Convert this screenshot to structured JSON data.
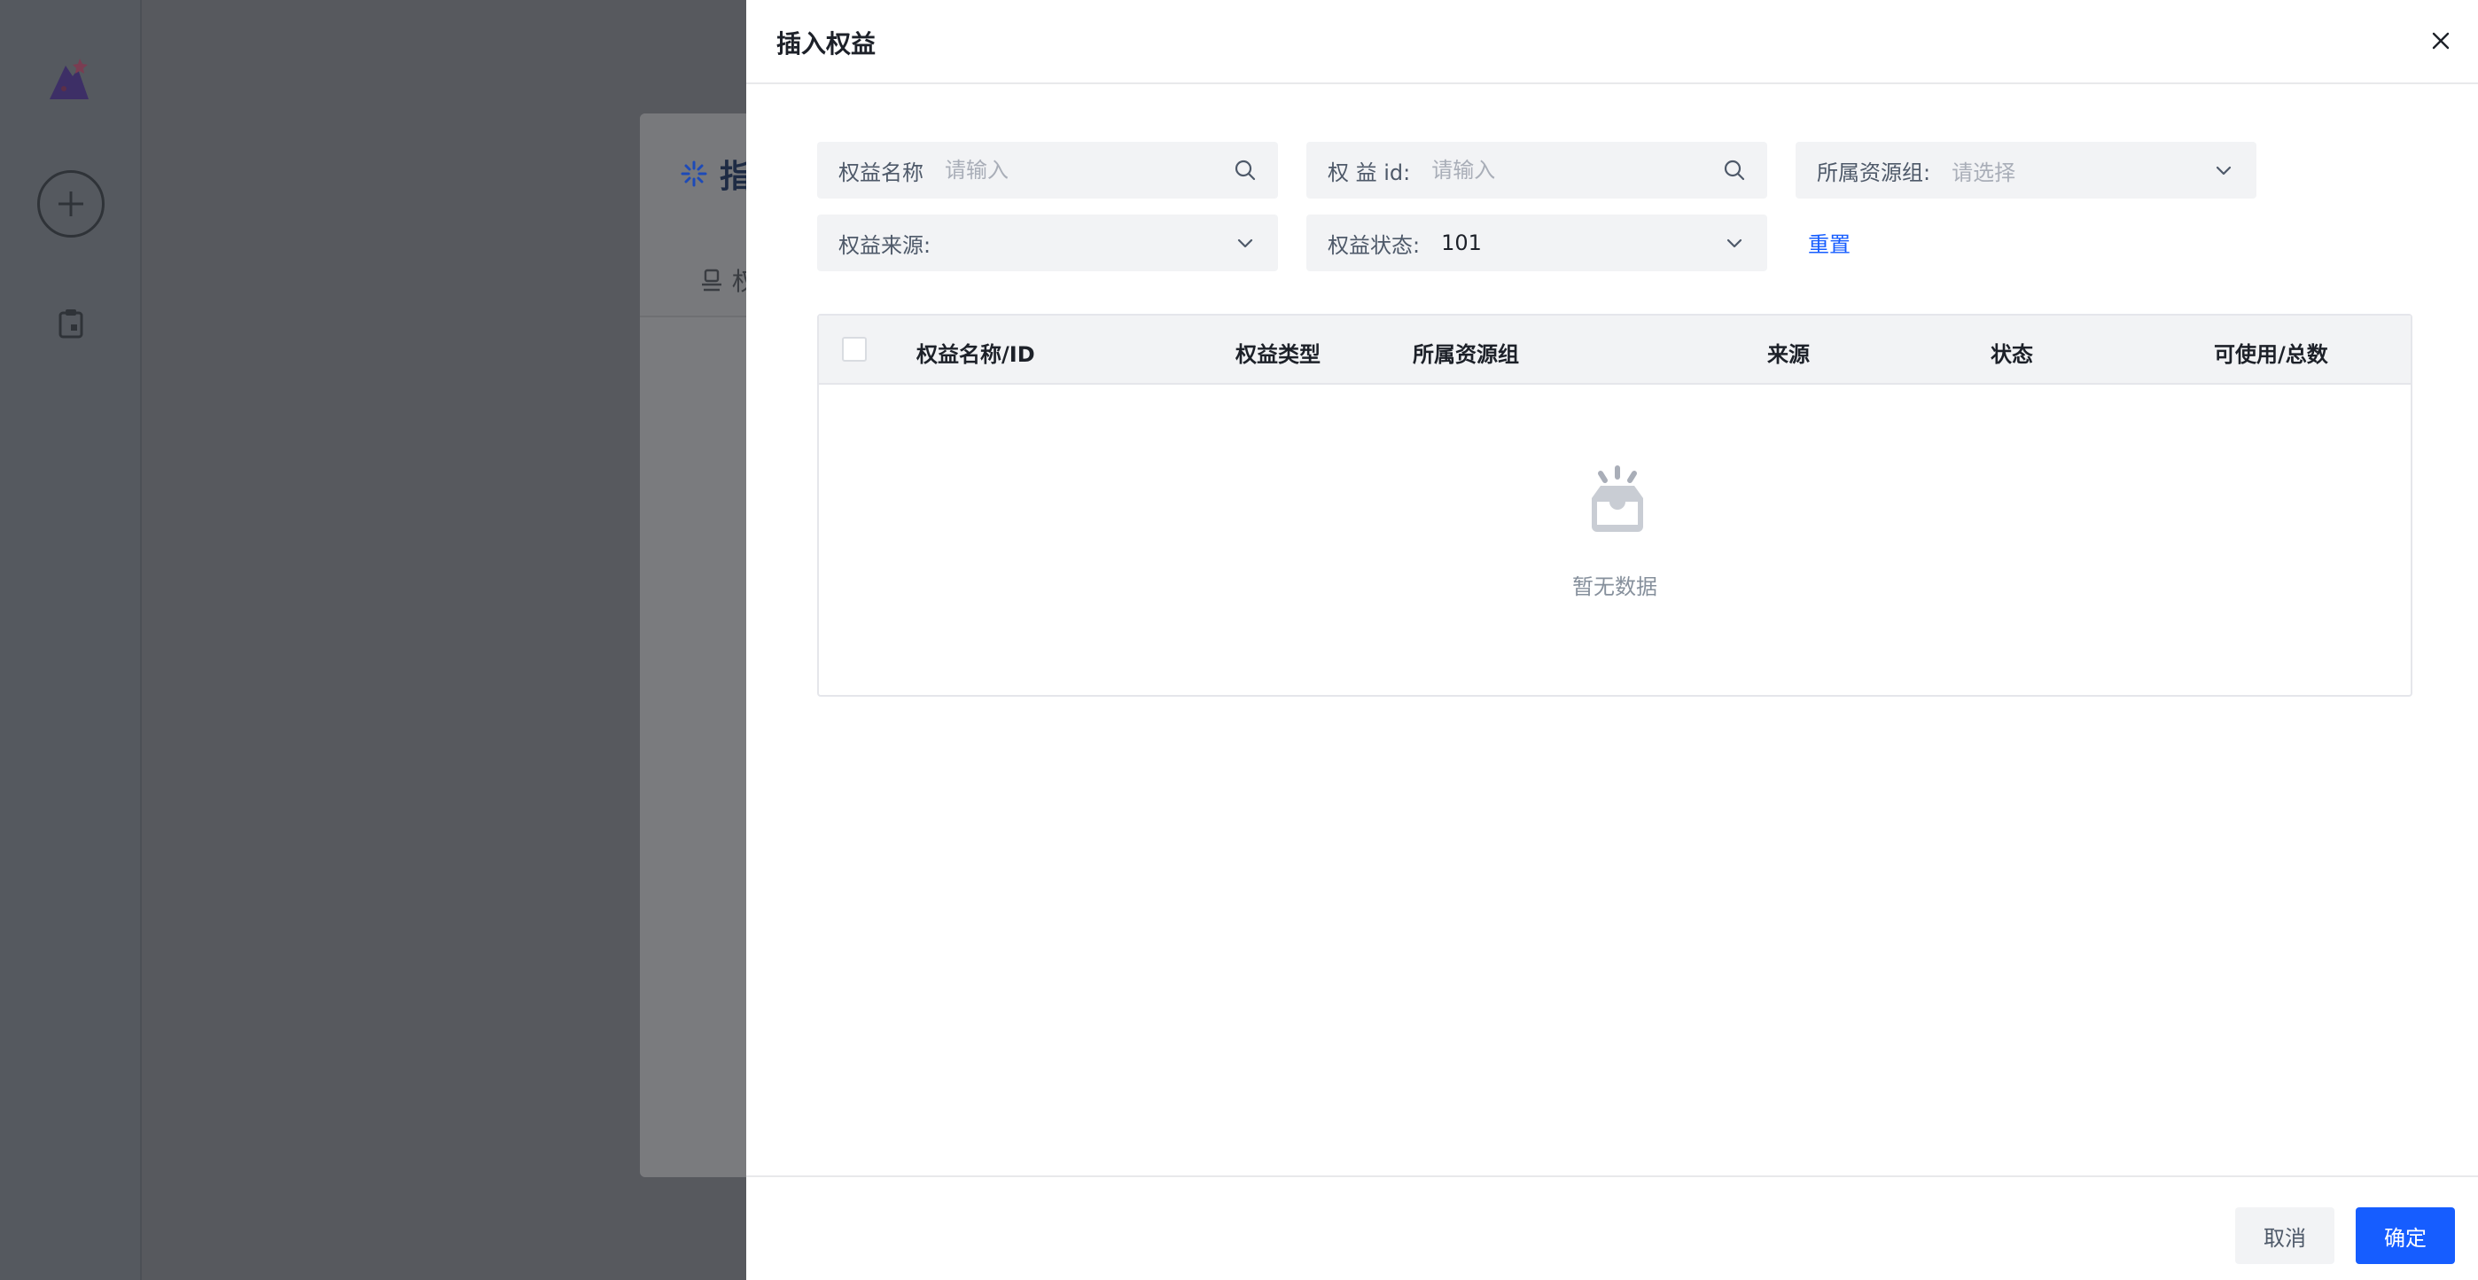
{
  "background": {
    "card_title_char": "指",
    "tab_char": "权"
  },
  "drawer": {
    "title": "插入权益",
    "close_icon": "close-icon"
  },
  "filters": {
    "name": {
      "label": "权益名称",
      "placeholder": "请输入"
    },
    "id": {
      "label": "权 益 id:",
      "placeholder": "请输入"
    },
    "group": {
      "label": "所属资源组:",
      "placeholder": "请选择"
    },
    "source": {
      "label": "权益来源:",
      "value": ""
    },
    "status": {
      "label": "权益状态:",
      "value": "101"
    },
    "reset_label": "重置"
  },
  "table": {
    "columns": [
      "权益名称/ID",
      "权益类型",
      "所属资源组",
      "来源",
      "状态",
      "可使用/总数"
    ],
    "rows": [],
    "empty_text": "暂无数据"
  },
  "footer": {
    "cancel_label": "取消",
    "ok_label": "确定"
  },
  "colors": {
    "primary": "#165dff",
    "overlay": "#565a60"
  }
}
